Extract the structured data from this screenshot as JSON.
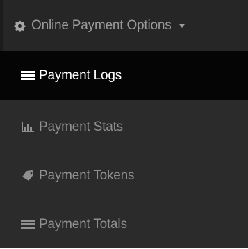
{
  "menu": {
    "header": {
      "label": "Online Payment Options",
      "icon": "gear-icon",
      "caret_icon": "caret-down-icon"
    },
    "items": [
      {
        "label": "Payment Logs",
        "icon": "list-icon",
        "active": true
      },
      {
        "label": "Payment Stats",
        "icon": "bar-chart-icon",
        "active": false
      },
      {
        "label": "Payment Tokens",
        "icon": "tag-icon",
        "active": false
      },
      {
        "label": "Payment Totals",
        "icon": "list-icon",
        "active": false
      }
    ]
  },
  "colors": {
    "header_background": "#262626",
    "submenu_background": "#2b2b2b",
    "active_background": "#050505",
    "active_text": "#ffffff",
    "inactive_text": "#8f8f8f"
  }
}
